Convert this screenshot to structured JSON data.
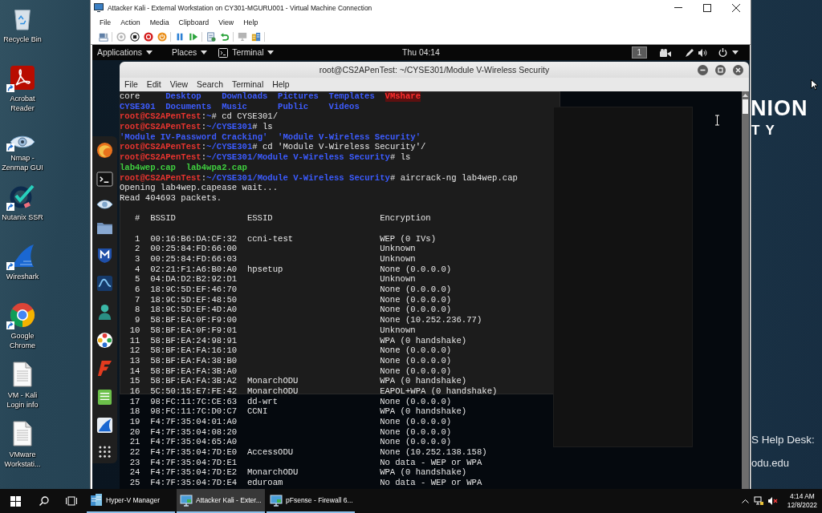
{
  "desktop_icons": [
    {
      "label": "Recycle Bin",
      "kind": "bin",
      "shortcut": false
    },
    {
      "label": "Acrobat Reader",
      "kind": "pdf",
      "shortcut": true
    },
    {
      "label": "Nmap - Zenmap GUI",
      "kind": "eye",
      "shortcut": true
    },
    {
      "label": "Nutanix SSR",
      "kind": "check",
      "shortcut": true
    },
    {
      "label": "Wireshark",
      "kind": "fin",
      "shortcut": true
    },
    {
      "label": "Google Chrome",
      "kind": "browser",
      "shortcut": true
    },
    {
      "label": "VM - Kali Login info",
      "kind": "document",
      "shortcut": false
    },
    {
      "label": "VMware Workstati...",
      "kind": "document",
      "shortcut": false
    }
  ],
  "vm_window": {
    "title": "Attacker Kali - External Workstation on CY301-MGURU001 - Virtual Machine Connection",
    "menu": [
      "File",
      "Action",
      "Media",
      "Clipboard",
      "View",
      "Help"
    ],
    "toolbar": [
      [
        {
          "kind": "keys",
          "disabled": false
        }
      ],
      [
        {
          "kind": "start",
          "disabled": true
        },
        {
          "kind": "stop",
          "disabled": false
        },
        {
          "kind": "shutdown",
          "disabled": false
        },
        {
          "kind": "power",
          "disabled": false
        }
      ],
      [
        {
          "kind": "pause",
          "disabled": false
        },
        {
          "kind": "reset",
          "disabled": false
        }
      ],
      [
        {
          "kind": "checkpoint",
          "disabled": false
        },
        {
          "kind": "revert",
          "disabled": false
        }
      ],
      [
        {
          "kind": "session",
          "disabled": true
        },
        {
          "kind": "share",
          "disabled": false
        }
      ]
    ]
  },
  "kali_topbar": {
    "menus": [
      {
        "label": "Applications",
        "kind": "plain"
      },
      {
        "label": "Places",
        "kind": "plain"
      },
      {
        "label": "Terminal",
        "kind": "terminal"
      }
    ],
    "clock": "Thu 04:14",
    "workspace": "1"
  },
  "terminal": {
    "title": "root@CS2APenTest: ~/CYSE301/Module V-Wireless Security",
    "menu": [
      "File",
      "Edit",
      "View",
      "Search",
      "Terminal",
      "Help"
    ],
    "lines": [
      {
        "kind": "listing",
        "rows": [
          [
            {
              "name": "core",
              "kind": "file"
            },
            {
              "name": "Desktop",
              "kind": "dir"
            },
            {
              "name": "Downloads",
              "kind": "dir"
            },
            {
              "name": "Pictures",
              "kind": "dir"
            },
            {
              "name": "Templates",
              "kind": "dir"
            },
            {
              "name": "VMshare",
              "kind": "shared"
            }
          ],
          [
            {
              "name": "CYSE301",
              "kind": "dir"
            },
            {
              "name": "Documents",
              "kind": "dir"
            },
            {
              "name": "Music",
              "kind": "dir"
            },
            {
              "name": "Public",
              "kind": "dir"
            },
            {
              "name": "Videos",
              "kind": "dir"
            }
          ]
        ]
      },
      {
        "kind": "prompt",
        "user": "root@CS2APenTest",
        "separator": ":",
        "path": "~",
        "symbol": "#",
        "command": "cd CYSE301/"
      },
      {
        "kind": "prompt",
        "user": "root@CS2APenTest",
        "separator": ":",
        "path": "~/CYSE301",
        "symbol": "#",
        "command": "ls"
      },
      {
        "kind": "listing",
        "rows": [
          [
            {
              "name": "'Module IV-Password Cracking'",
              "kind": "dir"
            },
            {
              "name": "'Module V-Wireless Security'",
              "kind": "dir"
            }
          ]
        ]
      },
      {
        "kind": "prompt",
        "user": "root@CS2APenTest",
        "separator": ":",
        "path": "~/CYSE301",
        "symbol": "#",
        "command": "cd 'Module V-Wireless Security'/"
      },
      {
        "kind": "prompt",
        "user": "root@CS2APenTest",
        "separator": ":",
        "path": "~/CYSE301/Module V-Wireless Security",
        "symbol": "#",
        "command": "ls"
      },
      {
        "kind": "listing",
        "rows": [
          [
            {
              "name": "lab4wep.cap",
              "kind": "exec"
            },
            {
              "name": "lab4wpa2.cap",
              "kind": "exec"
            }
          ]
        ]
      },
      {
        "kind": "prompt",
        "user": "root@CS2APenTest",
        "separator": ":",
        "path": "~/CYSE301/Module V-Wireless Security",
        "symbol": "#",
        "command": "aircrack-ng lab4wep.cap"
      },
      {
        "kind": "output",
        "text": "Opening lab4wep.capease wait..."
      },
      {
        "kind": "output",
        "text": "Read 404693 packets."
      }
    ],
    "networks": {
      "columns": [
        "#",
        "BSSID",
        "ESSID",
        "Encryption"
      ],
      "rows": [
        {
          "number": "1",
          "bssid": "00:16:B6:DA:CF:32",
          "essid": "ccni-test",
          "encryption": "WEP (0 IVs)"
        },
        {
          "number": "2",
          "bssid": "00:25:84:FD:66:00",
          "encryption": "Unknown"
        },
        {
          "number": "3",
          "bssid": "00:25:84:FD:66:03",
          "encryption": "Unknown"
        },
        {
          "number": "4",
          "bssid": "02:21:F1:A6:B0:A0",
          "essid": "hpsetup",
          "encryption": "None (0.0.0.0)"
        },
        {
          "number": "5",
          "bssid": "04:DA:D2:B2:92:D1",
          "encryption": "Unknown"
        },
        {
          "number": "6",
          "bssid": "18:9C:5D:EF:46:70",
          "encryption": "None (0.0.0.0)"
        },
        {
          "number": "7",
          "bssid": "18:9C:5D:EF:48:50",
          "encryption": "None (0.0.0.0)"
        },
        {
          "number": "8",
          "bssid": "18:9C:5D:EF:4D:A0",
          "encryption": "None (0.0.0.0)"
        },
        {
          "number": "9",
          "bssid": "58:BF:EA:0F:F9:00",
          "encryption": "None (10.252.236.77)"
        },
        {
          "number": "10",
          "bssid": "58:BF:EA:0F:F9:01",
          "encryption": "Unknown"
        },
        {
          "number": "11",
          "bssid": "58:BF:EA:24:98:91",
          "encryption": "WPA (0 handshake)"
        },
        {
          "number": "12",
          "bssid": "58:BF:EA:FA:16:10",
          "encryption": "None (0.0.0.0)"
        },
        {
          "number": "13",
          "bssid": "58:BF:EA:FA:38:B0",
          "encryption": "None (0.0.0.0)"
        },
        {
          "number": "14",
          "bssid": "58:BF:EA:FA:3B:A0",
          "encryption": "None (0.0.0.0)"
        },
        {
          "number": "15",
          "bssid": "58:BF:EA:FA:3B:A2",
          "essid": "MonarchODU",
          "encryption": "WPA (0 handshake)"
        },
        {
          "number": "16",
          "bssid": "5C:50:15:E7:FE:42",
          "essid": "MonarchODU",
          "encryption": "EAPOL+WPA (0 handshake)"
        },
        {
          "number": "17",
          "bssid": "98:FC:11:7C:CE:63",
          "essid": "dd-wrt",
          "encryption": "None (0.0.0.0)"
        },
        {
          "number": "18",
          "bssid": "98:FC:11:7C:D0:C7",
          "essid": "CCNI",
          "encryption": "WPA (0 handshake)"
        },
        {
          "number": "19",
          "bssid": "F4:7F:35:04:01:A0",
          "encryption": "None (0.0.0.0)"
        },
        {
          "number": "20",
          "bssid": "F4:7F:35:04:08:20",
          "encryption": "None (0.0.0.0)"
        },
        {
          "number": "21",
          "bssid": "F4:7F:35:04:65:A0",
          "encryption": "None (0.0.0.0)"
        },
        {
          "number": "22",
          "bssid": "F4:7F:35:04:7D:E0",
          "essid": "AccessODU",
          "encryption": "None (10.252.138.158)"
        },
        {
          "number": "23",
          "bssid": "F4:7F:35:04:7D:E1",
          "encryption": "No data - WEP or WPA"
        },
        {
          "number": "24",
          "bssid": "F4:7F:35:04:7D:E2",
          "essid": "MonarchODU",
          "encryption": "WPA (0 handshake)"
        },
        {
          "number": "25",
          "bssid": "F4:7F:35:04:7D:E4",
          "essid": "eduroam",
          "encryption": "No data - WEP or WPA"
        }
      ]
    }
  },
  "wallpaper": {
    "logo_line_1": "NION",
    "logo_line_2": "TY",
    "help_line": "S Help Desk:",
    "web_line": "odu.edu"
  },
  "taskbar": {
    "apps": [
      {
        "label": "Hyper-V Manager",
        "kind": "server",
        "selected": false
      },
      {
        "label": "Attacker Kali - Exter...",
        "kind": "vm",
        "selected": true
      },
      {
        "label": "pFsense - Firewall 6...",
        "kind": "vm",
        "selected": false
      }
    ],
    "time": "4:14 AM",
    "date": "12/8/2022"
  }
}
